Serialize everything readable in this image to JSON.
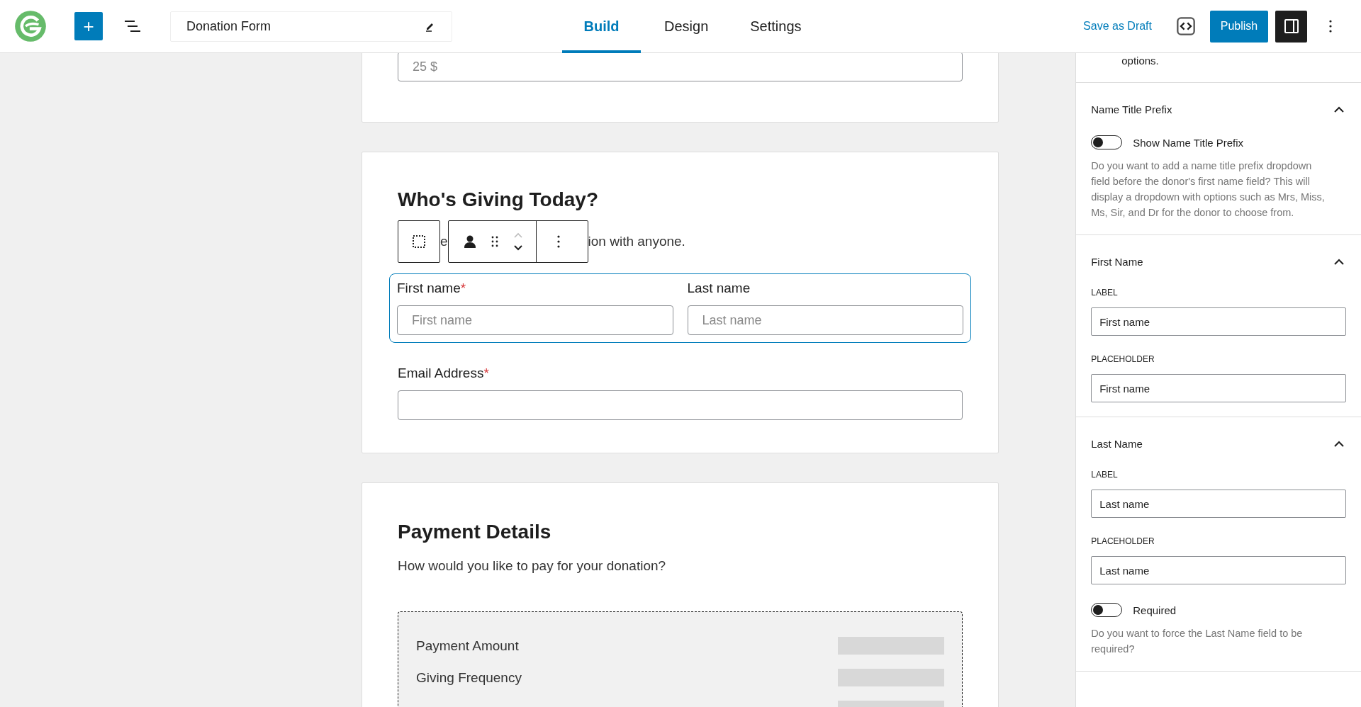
{
  "header": {
    "add_label": "+",
    "form_title": "Donation Form",
    "tabs": [
      {
        "label": "Build",
        "selected": true
      },
      {
        "label": "Design",
        "selected": false
      },
      {
        "label": "Settings",
        "selected": false
      }
    ],
    "save_draft": "Save as Draft",
    "publish": "Publish"
  },
  "canvas": {
    "amount_field": {
      "placeholder": "25 $"
    },
    "donor_section": {
      "title": "Who's Giving Today?",
      "description_parts": [
        "e",
        "ion with anyone."
      ],
      "selected": true,
      "name_fields": [
        {
          "label": "First name",
          "required": true,
          "placeholder": "First name"
        },
        {
          "label": "Last name",
          "required": false,
          "placeholder": "Last name"
        }
      ],
      "email": {
        "label": "Email Address",
        "required": true
      }
    },
    "required_mark": "*",
    "payment_section": {
      "title": "Payment Details",
      "description": "How would you like to pay for your donation?",
      "rows": [
        "Payment Amount",
        "Giving Frequency"
      ]
    }
  },
  "sidebar": {
    "top_text": "options.",
    "sections": [
      {
        "title": "Name Title Prefix",
        "expanded": true,
        "items": [
          {
            "kind": "toggle",
            "label": "Show Name Title Prefix",
            "on": false,
            "description": "Do you want to add a name title prefix dropdown field before the donor's first name field? This will display a dropdown with options such as Mrs, Miss, Ms, Sir, and Dr for the donor to choose from."
          }
        ]
      },
      {
        "title": "First Name",
        "expanded": true,
        "items": [
          {
            "kind": "input",
            "label": "LABEL",
            "value": "First name"
          },
          {
            "kind": "input",
            "label": "PLACEHOLDER",
            "value": "First name"
          }
        ]
      },
      {
        "title": "Last Name",
        "expanded": true,
        "items": [
          {
            "kind": "input",
            "label": "LABEL",
            "value": "Last name"
          },
          {
            "kind": "input",
            "label": "PLACEHOLDER",
            "value": "Last name"
          },
          {
            "kind": "toggle",
            "label": "Required",
            "on": false,
            "description": "Do you want to force the Last Name field to be required?"
          }
        ]
      }
    ]
  }
}
